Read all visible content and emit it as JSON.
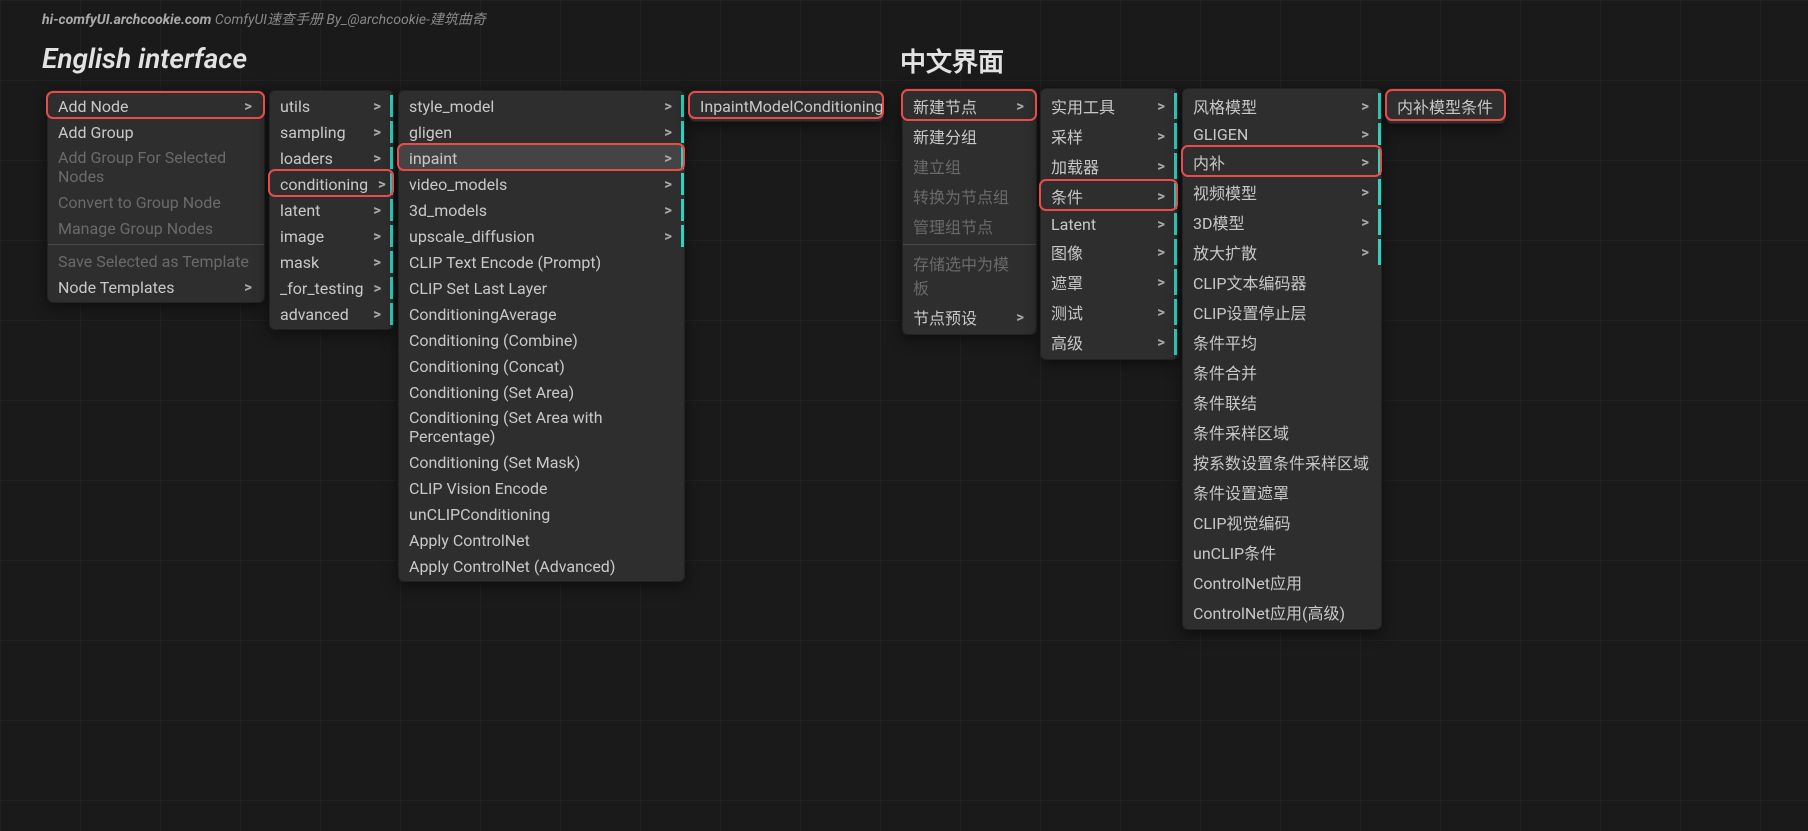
{
  "watermark": {
    "domain": "hi-comfyUI.archcookie.com",
    "rest": " ComfyUI速查手册 By_@archcookie-建筑曲奇"
  },
  "headings": {
    "en": "English interface",
    "cn": "中文界面"
  },
  "en": {
    "m1": [
      {
        "label": "Add Node",
        "arrow": true,
        "hl": true
      },
      {
        "label": "Add Group"
      },
      {
        "label": "Add Group For Selected Nodes",
        "disabled": true
      },
      {
        "label": "Convert to Group Node",
        "disabled": true
      },
      {
        "label": "Manage Group Nodes",
        "disabled": true
      },
      {
        "sep": true
      },
      {
        "label": "Save Selected as Template",
        "disabled": true
      },
      {
        "label": "Node Templates",
        "arrow": true
      }
    ],
    "m2": [
      {
        "label": "utils",
        "arrow": true,
        "teal": true
      },
      {
        "label": "sampling",
        "arrow": true,
        "teal": true
      },
      {
        "label": "loaders",
        "arrow": true,
        "teal": true
      },
      {
        "label": "conditioning",
        "arrow": true,
        "teal": true,
        "hl": true
      },
      {
        "label": "latent",
        "arrow": true,
        "teal": true
      },
      {
        "label": "image",
        "arrow": true,
        "teal": true
      },
      {
        "label": "mask",
        "arrow": true,
        "teal": true
      },
      {
        "label": "_for_testing",
        "arrow": true,
        "teal": true
      },
      {
        "label": "advanced",
        "arrow": true,
        "teal": true
      }
    ],
    "m3": [
      {
        "label": "style_model",
        "arrow": true,
        "teal": true
      },
      {
        "label": "gligen",
        "arrow": true,
        "teal": true
      },
      {
        "label": "inpaint",
        "arrow": true,
        "teal": true,
        "hl": true,
        "selected": true
      },
      {
        "label": "video_models",
        "arrow": true,
        "teal": true
      },
      {
        "label": "3d_models",
        "arrow": true,
        "teal": true
      },
      {
        "label": "upscale_diffusion",
        "arrow": true,
        "teal": true
      },
      {
        "label": "CLIP Text Encode (Prompt)"
      },
      {
        "label": "CLIP Set Last Layer"
      },
      {
        "label": "ConditioningAverage"
      },
      {
        "label": "Conditioning (Combine)"
      },
      {
        "label": "Conditioning (Concat)"
      },
      {
        "label": "Conditioning (Set Area)"
      },
      {
        "label": "Conditioning (Set Area with Percentage)"
      },
      {
        "label": "Conditioning (Set Mask)"
      },
      {
        "label": "CLIP Vision Encode"
      },
      {
        "label": "unCLIPConditioning"
      },
      {
        "label": "Apply ControlNet"
      },
      {
        "label": "Apply ControlNet (Advanced)"
      }
    ],
    "m4": [
      {
        "label": "InpaintModelConditioning",
        "hl": true
      }
    ]
  },
  "cn": {
    "m1": [
      {
        "label": "新建节点",
        "arrow": true,
        "hl": true
      },
      {
        "label": "新建分组"
      },
      {
        "label": "建立组",
        "disabled": true
      },
      {
        "label": "转换为节点组",
        "disabled": true
      },
      {
        "label": "管理组节点",
        "disabled": true
      },
      {
        "sep": true
      },
      {
        "label": "存储选中为模板",
        "disabled": true
      },
      {
        "label": "节点预设",
        "arrow": true
      }
    ],
    "m2": [
      {
        "label": "实用工具",
        "arrow": true,
        "teal": true
      },
      {
        "label": "采样",
        "arrow": true,
        "teal": true
      },
      {
        "label": "加载器",
        "arrow": true,
        "teal": true
      },
      {
        "label": "条件",
        "arrow": true,
        "teal": true,
        "hl": true
      },
      {
        "label": "Latent",
        "arrow": true,
        "teal": true
      },
      {
        "label": "图像",
        "arrow": true,
        "teal": true
      },
      {
        "label": "遮罩",
        "arrow": true,
        "teal": true
      },
      {
        "label": "测试",
        "arrow": true,
        "teal": true
      },
      {
        "label": "高级",
        "arrow": true,
        "teal": true
      }
    ],
    "m3": [
      {
        "label": "风格模型",
        "arrow": true,
        "teal": true
      },
      {
        "label": "GLIGEN",
        "arrow": true,
        "teal": true
      },
      {
        "label": "内补",
        "arrow": true,
        "teal": true,
        "hl": true
      },
      {
        "label": "视频模型",
        "arrow": true,
        "teal": true
      },
      {
        "label": "3D模型",
        "arrow": true,
        "teal": true
      },
      {
        "label": "放大扩散",
        "arrow": true,
        "teal": true
      },
      {
        "label": "CLIP文本编码器"
      },
      {
        "label": "CLIP设置停止层"
      },
      {
        "label": "条件平均"
      },
      {
        "label": "条件合并"
      },
      {
        "label": "条件联结"
      },
      {
        "label": "条件采样区域"
      },
      {
        "label": "按系数设置条件采样区域"
      },
      {
        "label": "条件设置遮罩"
      },
      {
        "label": "CLIP视觉编码"
      },
      {
        "label": "unCLIP条件"
      },
      {
        "label": "ControlNet应用"
      },
      {
        "label": "ControlNet应用(高级)"
      }
    ],
    "m4": [
      {
        "label": "内补模型条件",
        "hl": true
      }
    ]
  }
}
